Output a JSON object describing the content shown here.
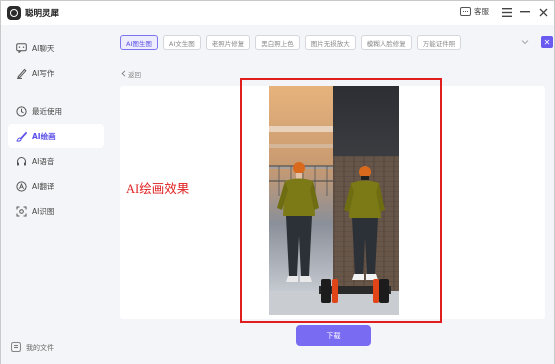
{
  "app": {
    "title": "聪明灵犀",
    "feedback_label": "客服"
  },
  "sidebar": {
    "items": [
      {
        "label": "AI聊天",
        "icon": "chat-icon",
        "active": false
      },
      {
        "label": "AI写作",
        "icon": "pen-icon",
        "active": false
      },
      {
        "label": "最近使用",
        "icon": "clock-icon",
        "active": false
      },
      {
        "label": "AI绘画",
        "icon": "brush-icon",
        "active": true
      },
      {
        "label": "AI语音",
        "icon": "headset-icon",
        "active": false
      },
      {
        "label": "AI翻译",
        "icon": "translate-icon",
        "active": false
      },
      {
        "label": "AI识图",
        "icon": "scan-icon",
        "active": false
      }
    ],
    "my_files": "我的文件"
  },
  "tabs": [
    {
      "label": "AI图生图",
      "active": true
    },
    {
      "label": "AI文生图",
      "active": false
    },
    {
      "label": "老照片修复",
      "active": false
    },
    {
      "label": "黑白照上色",
      "active": false
    },
    {
      "label": "图片无损放大",
      "active": false
    },
    {
      "label": "模糊人脸修复",
      "active": false
    },
    {
      "label": "万能证件照",
      "active": false
    }
  ],
  "back_label": "返回",
  "panel": {
    "annotation": "AI绘画效果"
  },
  "download_label": "下载",
  "colors": {
    "accent": "#7a6cf2",
    "annotation": "#e02020"
  }
}
